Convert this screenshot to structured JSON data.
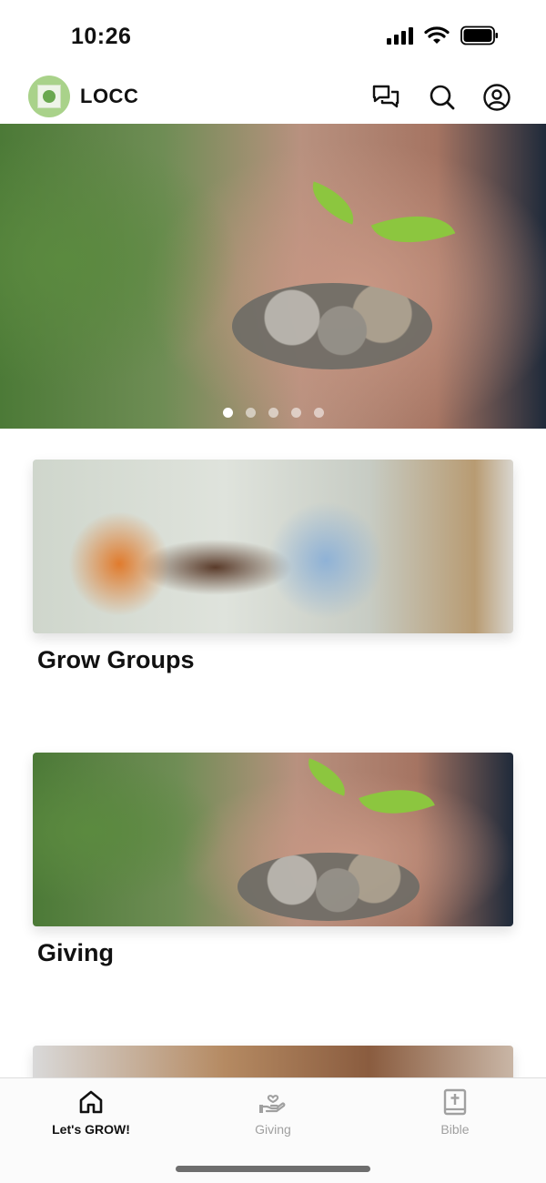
{
  "status_bar": {
    "time": "10:26"
  },
  "header": {
    "app_title": "LOCC"
  },
  "hero": {
    "dot_count": 5,
    "active_dot": 0
  },
  "cards": [
    {
      "title": "Grow Groups"
    },
    {
      "title": "Giving"
    },
    {
      "title": ""
    }
  ],
  "tab_bar": {
    "tabs": [
      {
        "label": "Let's GROW!",
        "icon": "home-icon",
        "active": true
      },
      {
        "label": "Giving",
        "icon": "giving-hand-heart-icon",
        "active": false
      },
      {
        "label": "Bible",
        "icon": "bible-icon",
        "active": false
      }
    ]
  },
  "colors": {
    "logo_bg": "#a9d28a",
    "active_tab": "#111111",
    "inactive_tab": "#a0a0a0"
  }
}
